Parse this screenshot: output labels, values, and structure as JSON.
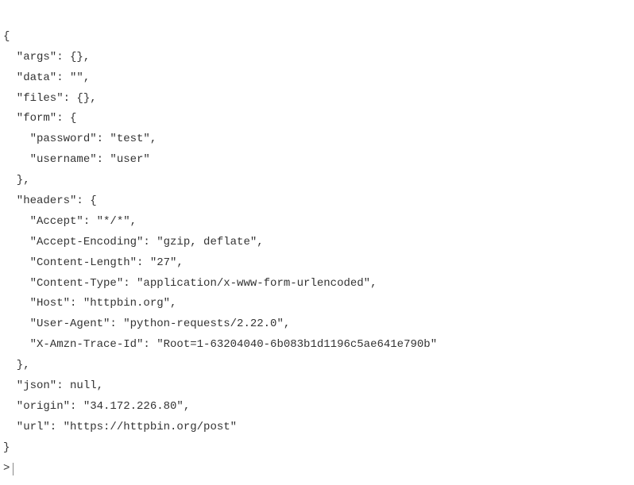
{
  "lines": [
    "{",
    "  \"args\": {}, ",
    "  \"data\": \"\", ",
    "  \"files\": {}, ",
    "  \"form\": {",
    "    \"password\": \"test\", ",
    "    \"username\": \"user\"",
    "  }, ",
    "  \"headers\": {",
    "    \"Accept\": \"*/*\", ",
    "    \"Accept-Encoding\": \"gzip, deflate\", ",
    "    \"Content-Length\": \"27\", ",
    "    \"Content-Type\": \"application/x-www-form-urlencoded\", ",
    "    \"Host\": \"httpbin.org\", ",
    "    \"User-Agent\": \"python-requests/2.22.0\", ",
    "    \"X-Amzn-Trace-Id\": \"Root=1-63204040-6b083b1d1196c5ae641e790b\"",
    "  }, ",
    "  \"json\": null, ",
    "  \"origin\": \"34.172.226.80\", ",
    "  \"url\": \"https://httpbin.org/post\"",
    "}"
  ],
  "prompt": ">"
}
